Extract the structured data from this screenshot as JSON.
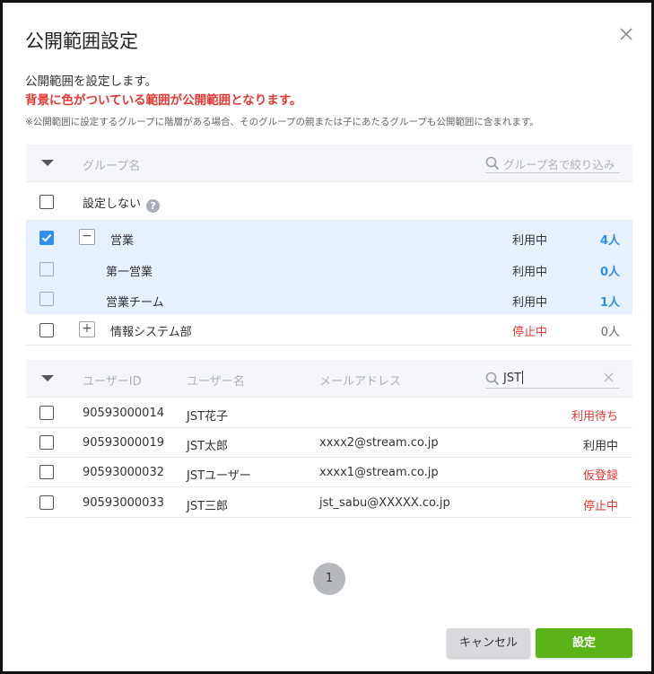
{
  "dialog": {
    "title": "公開範囲設定",
    "description": "公開範囲を設定します。",
    "warning": "背景に色がついている範囲が公開範囲となります。",
    "note": "※公開範囲に設定するグループに階層がある場合、そのグループの親または子にあたるグループも公開範囲に含まれます。"
  },
  "group_table": {
    "column_name": "グループ名",
    "filter_placeholder": "グループ名で絞り込み",
    "rows": [
      {
        "name": "設定しない",
        "status": "",
        "count": "",
        "checked": false
      },
      {
        "name": "営業",
        "status": "利用中",
        "count": "4人",
        "checked": true,
        "toggle": "−"
      },
      {
        "name": "第一営業",
        "status": "利用中",
        "count": "0人",
        "checked": false
      },
      {
        "name": "営業チーム",
        "status": "利用中",
        "count": "1人",
        "checked": false
      },
      {
        "name": "情報システム部",
        "status": "停止中",
        "count": "0人",
        "checked": false,
        "toggle": "+"
      }
    ]
  },
  "user_table": {
    "column_user_id": "ユーザーID",
    "column_user_name": "ユーザー名",
    "column_email": "メールアドレス",
    "search_value": "JST",
    "rows": [
      {
        "id": "90593000014",
        "name": "JST花子",
        "email": "",
        "status": "利用待ち"
      },
      {
        "id": "90593000019",
        "name": "JST太郎",
        "email": "xxxx2@stream.co.jp",
        "status": "利用中"
      },
      {
        "id": "90593000032",
        "name": "JSTユーザー",
        "email": "xxxx1@stream.co.jp",
        "status": "仮登録"
      },
      {
        "id": "90593000033",
        "name": "JST三郎",
        "email": "jst_sabu@XXXXX.co.jp",
        "status": "停止中"
      }
    ]
  },
  "pagination": {
    "current_page": "1"
  },
  "buttons": {
    "cancel": "キャンセル",
    "ok": "設定"
  },
  "colors": {
    "accent_blue": "#2f8ef0",
    "ok_green": "#5bb318",
    "warning_red": "#e53935",
    "selected_row": "#e6f1fd"
  }
}
